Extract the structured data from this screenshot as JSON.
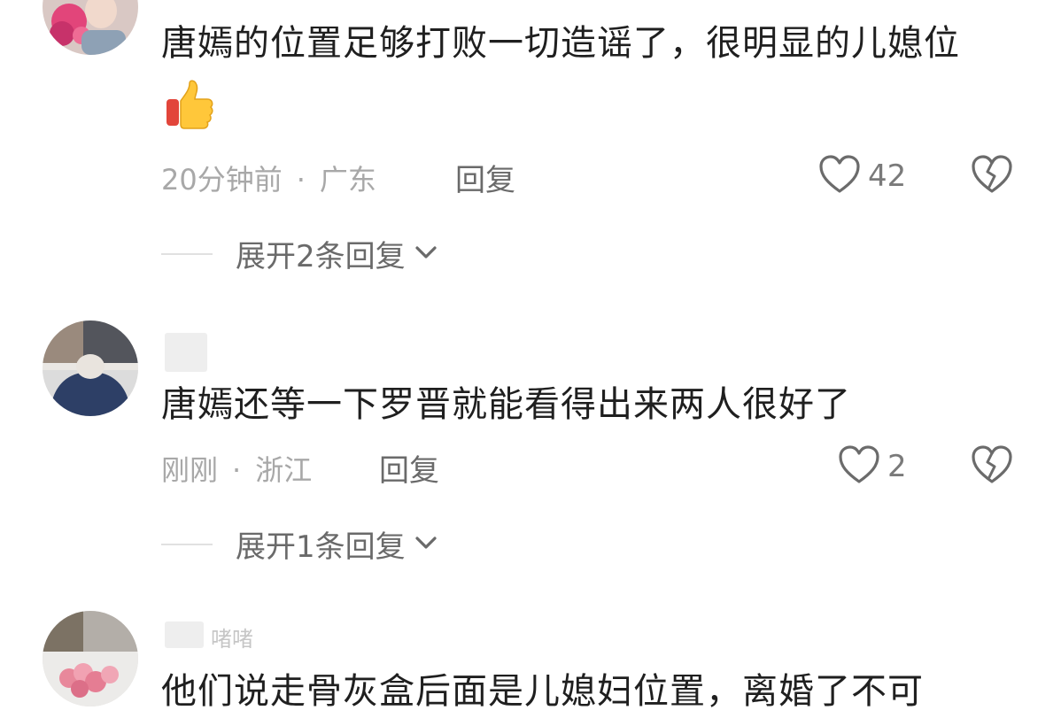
{
  "comments": [
    {
      "text": "唐嫣的位置足够打败一切造谣了，很明显的儿媳位",
      "time": "20分钟前",
      "separator": "·",
      "location": "广东",
      "reply_label": "回复",
      "likes": "42",
      "expand_label": "展开2条回复",
      "emoji": "thumbs-up"
    },
    {
      "text": "唐嫣还等一下罗晋就能看得出来两人很好了",
      "time": "刚刚",
      "separator": "·",
      "location": "浙江",
      "reply_label": "回复",
      "likes": "2",
      "expand_label": "展开1条回复"
    },
    {
      "username": "啫啫",
      "text": "他们说走骨灰盒后面是儿媳妇位置，离婚了不可"
    }
  ],
  "colors": {
    "text": "#1f1f1f",
    "meta": "#a8a8a8",
    "action": "#6a6a6a"
  }
}
